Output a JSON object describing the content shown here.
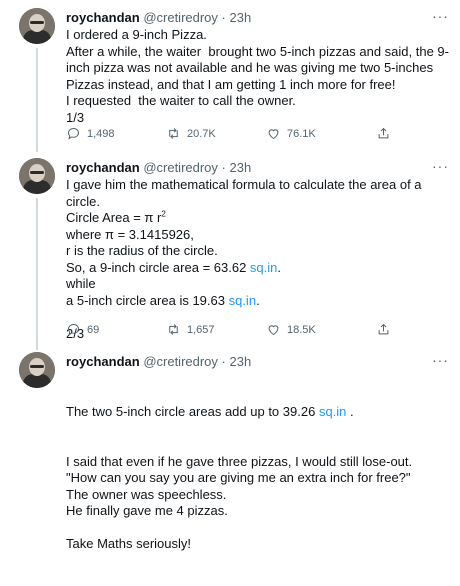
{
  "tweets": [
    {
      "name": "roychandan",
      "handle": "@cretiredroy",
      "dot": "·",
      "time": "23h",
      "more": "···",
      "text": "I ordered a 9-inch Pizza.\nAfter a while, the waiter  brought two 5-inch pizzas and said, the 9-inch pizza was not available and he was giving me two 5-inches Pizzas instead, and that I am getting 1 inch more for free!\nI requested  the waiter to call the owner.\n1/3",
      "replies": "1,498",
      "retweets": "20.7K",
      "likes": "76.1K"
    },
    {
      "name": "roychandan",
      "handle": "@cretiredroy",
      "dot": "·",
      "time": "23h",
      "more": "···",
      "line1": "I gave him the  mathematical formula to calculate the area of a circle.",
      "line2_pre": "Circle Area = π r",
      "line2_sup": "2",
      "line3": "where π = 3.1415926,",
      "line4": "r is the radius of the circle.",
      "line5_pre": "So, a 9-inch circle area = 63.62 ",
      "line5_link": "sq.in",
      "line5_post": ".",
      "line6": "while",
      "line7_pre": "a 5-inch circle area is 19.63 ",
      "line7_link": "sq.in",
      "line7_post": ".",
      "line8": "2/3",
      "replies": "69",
      "retweets": "1,657",
      "likes": "18.5K"
    },
    {
      "name": "roychandan",
      "handle": "@cretiredroy",
      "dot": "·",
      "time": "23h",
      "more": "···",
      "line1_pre": "The two 5-inch circle areas add up to 39.26 ",
      "line1_link": "sq.in",
      "line1_post": " .",
      "rest": "I said that even if he gave three pizzas, I would still lose-out.\n\"How can you say you are giving me an extra inch for free?\"\nThe owner was speechless.\nHe finally gave me 4 pizzas.\n\nTake Maths seriously!"
    }
  ]
}
